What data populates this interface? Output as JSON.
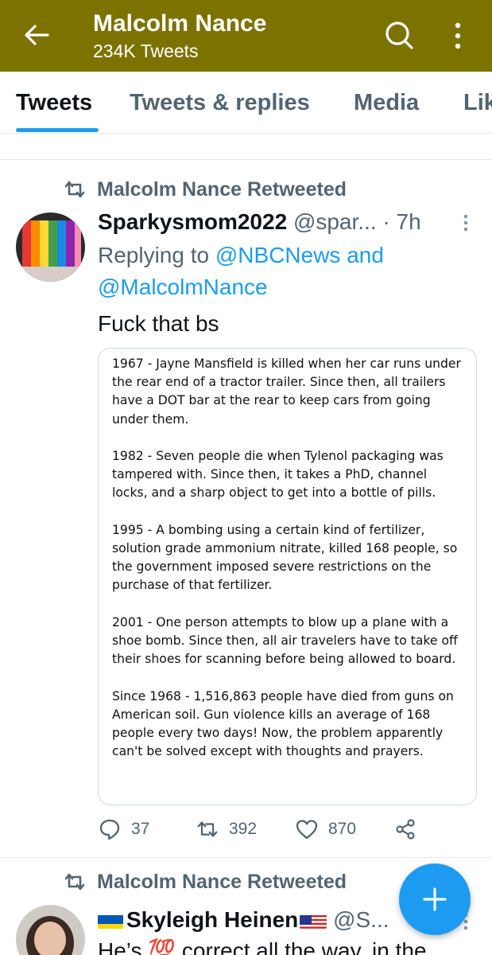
{
  "header": {
    "title": "Malcolm Nance",
    "subtitle": "234K Tweets",
    "bg_color": "#7c7200",
    "back_icon": "arrow-left-icon",
    "search_icon": "search-icon",
    "more_icon": "more-vertical-icon"
  },
  "tabs": [
    {
      "label": "Tweets",
      "active": true
    },
    {
      "label": "Tweets & replies",
      "active": false
    },
    {
      "label": "Media",
      "active": false
    },
    {
      "label": "Likes",
      "active": false
    }
  ],
  "accent_color": "#1d9bf0",
  "tweets": [
    {
      "retweeted_by": "Malcolm Nance Retweeted",
      "name": "Sparkysmom2022",
      "handle": "@spar...",
      "dot": "·",
      "time": "7h",
      "replying_to": "Replying to",
      "mention1": "@NBCNews",
      "and": "and",
      "mention2": "@MalcolmNance",
      "text": "Fuck that bs",
      "media_paragraphs": [
        "1967 - Jayne Mansfield is killed when her car runs under the rear end of a tractor trailer. Since then, all trailers have a DOT bar at the rear to keep cars from going under them.",
        "1982 - Seven people die when Tylenol packaging was tampered with. Since then, it takes a PhD, channel locks, and a sharp object to get into a bottle of pills.",
        "1995 - A bombing using a certain kind of fertilizer, solution grade ammonium nitrate, killed 168 people, so the government imposed severe restrictions on the purchase of that fertilizer.",
        "2001 - One person attempts to blow up a plane with a shoe bomb. Since then, all air travelers have to take off their shoes for scanning before being allowed to board.",
        "Since 1968 - 1,516,863 people have died from guns on American soil. Gun violence kills an average of 168 people every two days! Now, the problem apparently can't be solved except with thoughts and prayers."
      ],
      "replies": "37",
      "retweets": "392",
      "likes": "870"
    },
    {
      "retweeted_by": "Malcolm Nance Retweeted",
      "name": "Skyleigh Heinen",
      "handle": "@S...",
      "text": "He’s 💯 correct all the way, in the"
    }
  ],
  "fab_icon": "plus-icon"
}
